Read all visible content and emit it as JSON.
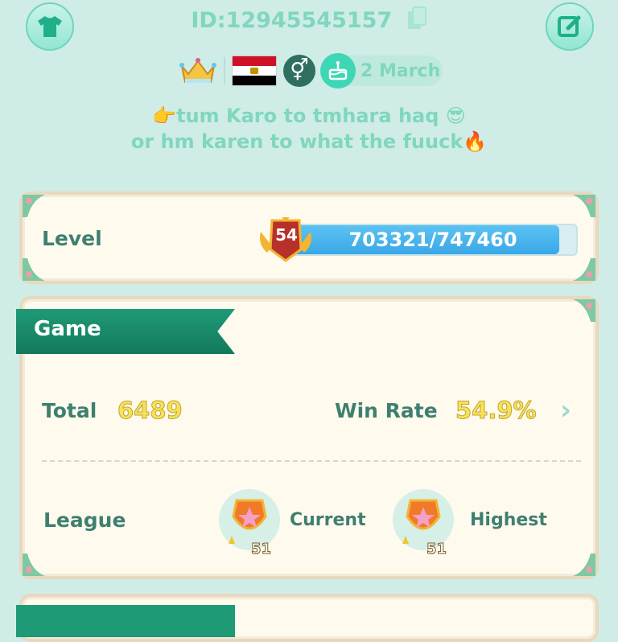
{
  "header": {
    "id_label": "ID:12945545157",
    "birthday": "2 March",
    "bio_line1": "👉tum Karo to tmhara haq 😎",
    "bio_line2": "or hm karen to what the fuuck🔥"
  },
  "level": {
    "label": "Level",
    "number": "54",
    "xp_text": "703321/747460",
    "xp_fraction": 0.941
  },
  "game": {
    "section_title": "Game",
    "total_label": "Total",
    "total_value": "6489",
    "win_rate_label": "Win Rate",
    "win_rate_value": "54.9%",
    "more_icon": "›",
    "league_label": "League",
    "current_label": "Current",
    "current_level": "51",
    "highest_label": "Highest",
    "highest_level": "51"
  },
  "icons": {
    "shirt": "shirt-icon",
    "edit": "edit-icon",
    "copy": "copy-icon",
    "crown": "crown-icon",
    "flag": "egypt-flag-icon",
    "gender": "gender-icon",
    "cake": "cake-icon",
    "more": "chevron-right-icon"
  },
  "colors": {
    "background": "#cfece6",
    "accent_green": "#1f9a76",
    "text_mint": "#7fd7be",
    "xp_blue": "#3aa7e6",
    "value_yellow": "#f3e35a"
  }
}
